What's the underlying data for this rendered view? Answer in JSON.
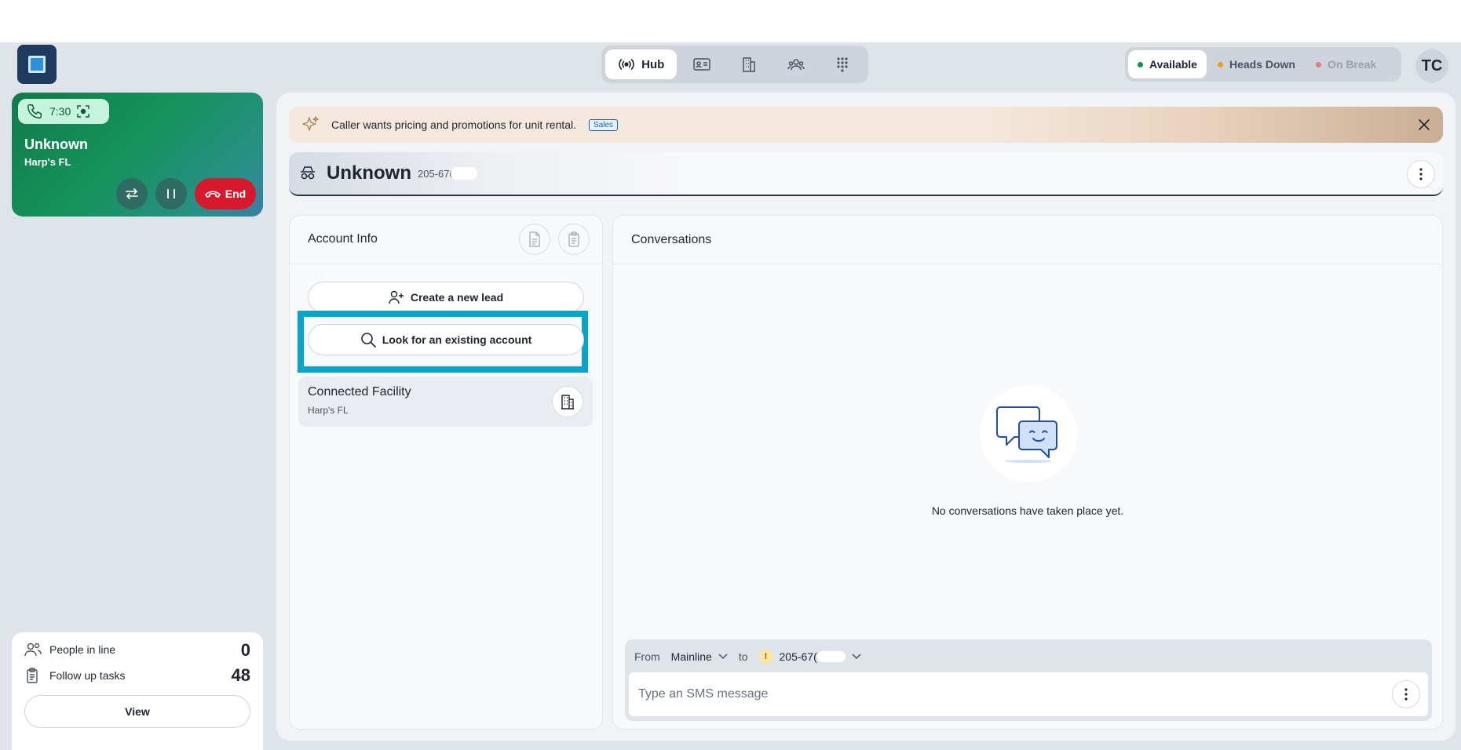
{
  "nav": {
    "hub_label": "Hub"
  },
  "status": {
    "available": "Available",
    "heads_down": "Heads Down",
    "on_break": "On Break"
  },
  "user": {
    "initials": "TC"
  },
  "call": {
    "timer": "7:30",
    "caller": "Unknown",
    "facility": "Harp's FL",
    "end_label": "End"
  },
  "queue": {
    "people_label": "People in line",
    "people_count": "0",
    "tasks_label": "Follow up tasks",
    "tasks_count": "48",
    "view_label": "View"
  },
  "banner": {
    "text": "Caller wants pricing and promotions for unit rental.",
    "badge": "Sales"
  },
  "header": {
    "title": "Unknown",
    "phone": "205-676"
  },
  "account": {
    "title": "Account Info",
    "create_lead": "Create a new lead",
    "look_existing": "Look for an existing account",
    "connected_title": "Connected Facility",
    "connected_sub": "Harp's FL"
  },
  "conversations": {
    "title": "Conversations",
    "empty": "No conversations have taken place yet.",
    "from_label": "From",
    "from_value": "Mainline",
    "to_label": "to",
    "to_badge": "!",
    "to_value": "205-67(",
    "placeholder": "Type an SMS message"
  },
  "colors": {
    "accent_green": "#14935a",
    "end_red": "#d6192d",
    "highlight": "#06a6cc",
    "available_dot": "#1a8f4f",
    "heads_down_dot": "#e8a317",
    "break_dot": "#e07a85"
  }
}
